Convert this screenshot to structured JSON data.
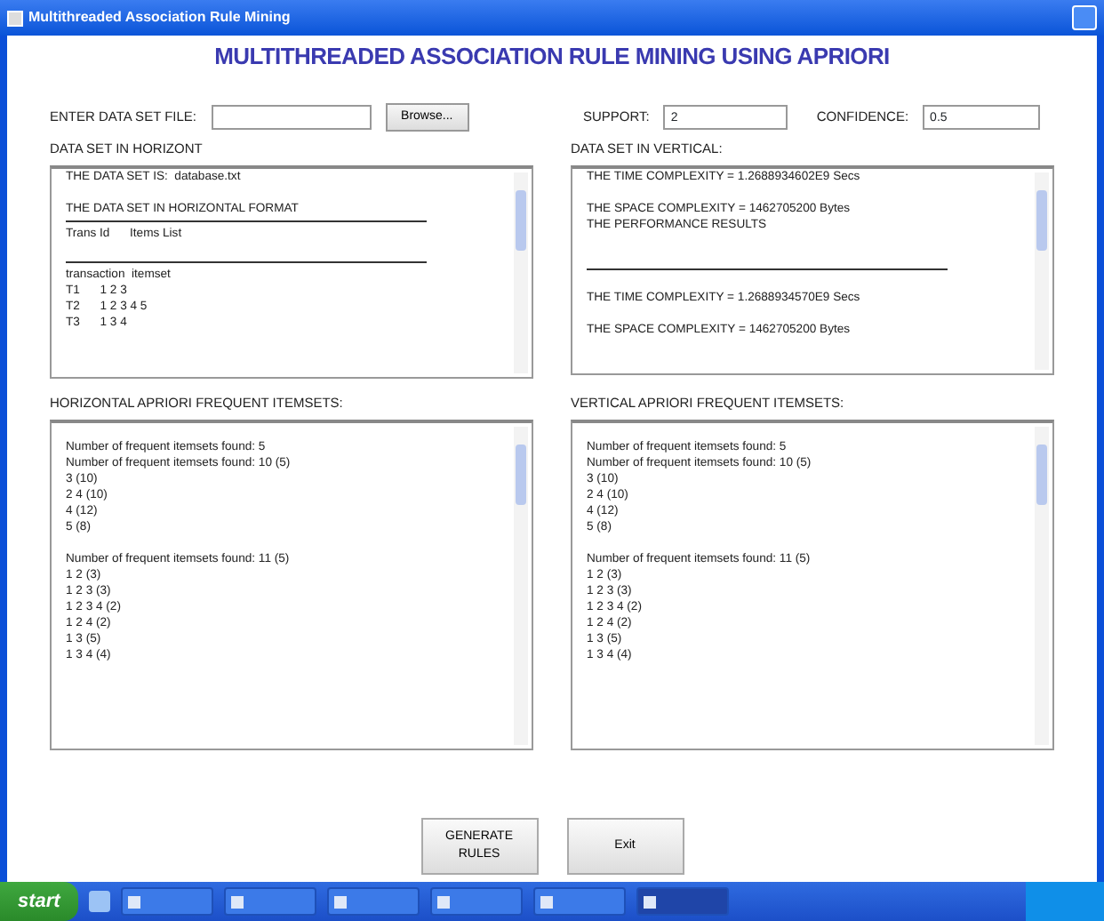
{
  "window": {
    "title": "Multithreaded Association Rule Mining"
  },
  "heading": "MULTITHREADED ASSOCIATION RULE MINING USING APRIORI",
  "file_input": {
    "label": "ENTER DATA SET FILE:",
    "button": "Browse..."
  },
  "support": {
    "label": "SUPPORT:",
    "value": "2"
  },
  "confidence": {
    "label": "CONFIDENCE:",
    "value": "0.5"
  },
  "panes": [
    {
      "label": "DATA SET IN HORIZONT",
      "lines": [
        {
          "kind": "text",
          "text": "THE DATA SET IS:  database.txt"
        },
        {
          "kind": "blank"
        },
        {
          "kind": "text",
          "text": "THE DATA SET IN HORIZONTAL FORMAT"
        },
        {
          "kind": "rule"
        },
        {
          "kind": "text",
          "text": "Trans Id      Items List"
        },
        {
          "kind": "blank"
        },
        {
          "kind": "rule"
        },
        {
          "kind": "text",
          "text": "transaction  itemset"
        },
        {
          "kind": "text",
          "text": "T1      1 2 3"
        },
        {
          "kind": "text",
          "text": "T2      1 2 3 4 5"
        },
        {
          "kind": "text",
          "text": "T3      1 3 4"
        }
      ]
    },
    {
      "label": "DATA SET IN VERTICAL:",
      "lines": [
        {
          "kind": "text",
          "text": "THE TIME COMPLEXITY = 1.2688934602E9 Secs"
        },
        {
          "kind": "blank"
        },
        {
          "kind": "text",
          "text": "THE SPACE COMPLEXITY = 1462705200 Bytes"
        },
        {
          "kind": "text",
          "text": "THE PERFORMANCE RESULTS"
        },
        {
          "kind": "blank"
        },
        {
          "kind": "blank"
        },
        {
          "kind": "rule"
        },
        {
          "kind": "blank"
        },
        {
          "kind": "text",
          "text": "THE TIME COMPLEXITY = 1.2688934570E9 Secs"
        },
        {
          "kind": "blank"
        },
        {
          "kind": "text",
          "text": "THE SPACE COMPLEXITY = 1462705200 Bytes"
        }
      ]
    },
    {
      "label": "HORIZONTAL APRIORI FREQUENT ITEMSETS:",
      "lines": [
        {
          "kind": "blank"
        },
        {
          "kind": "text",
          "text": "Number of frequent itemsets found: 5"
        },
        {
          "kind": "text",
          "text": "Number of frequent itemsets found: 10 (5)"
        },
        {
          "kind": "text",
          "text": "3 (10)"
        },
        {
          "kind": "text",
          "text": "2 4 (10)"
        },
        {
          "kind": "text",
          "text": "4 (12)"
        },
        {
          "kind": "text",
          "text": "5 (8)"
        },
        {
          "kind": "blank"
        },
        {
          "kind": "text",
          "text": "Number of frequent itemsets found: 11 (5)"
        },
        {
          "kind": "text",
          "text": "1 2 (3)"
        },
        {
          "kind": "text",
          "text": "1 2 3 (3)"
        },
        {
          "kind": "text",
          "text": "1 2 3 4 (2)"
        },
        {
          "kind": "text",
          "text": "1 2 4 (2)"
        },
        {
          "kind": "text",
          "text": "1 3 (5)"
        },
        {
          "kind": "text",
          "text": "1 3 4 (4)"
        }
      ]
    },
    {
      "label": "VERTICAL APRIORI FREQUENT ITEMSETS:",
      "lines": [
        {
          "kind": "blank"
        },
        {
          "kind": "text",
          "text": "Number of frequent itemsets found: 5"
        },
        {
          "kind": "text",
          "text": "Number of frequent itemsets found: 10 (5)"
        },
        {
          "kind": "text",
          "text": "3 (10)"
        },
        {
          "kind": "text",
          "text": "2 4 (10)"
        },
        {
          "kind": "text",
          "text": "4 (12)"
        },
        {
          "kind": "text",
          "text": "5 (8)"
        },
        {
          "kind": "blank"
        },
        {
          "kind": "text",
          "text": "Number of frequent itemsets found: 11 (5)"
        },
        {
          "kind": "text",
          "text": "1 2 (3)"
        },
        {
          "kind": "text",
          "text": "1 2 3 (3)"
        },
        {
          "kind": "text",
          "text": "1 2 3 4 (2)"
        },
        {
          "kind": "text",
          "text": "1 2 4 (2)"
        },
        {
          "kind": "text",
          "text": "1 3 (5)"
        },
        {
          "kind": "text",
          "text": "1 3 4 (4)"
        }
      ]
    }
  ],
  "buttons": [
    "GENERATE RULES",
    "Exit"
  ],
  "taskbar": {
    "start": "start"
  }
}
